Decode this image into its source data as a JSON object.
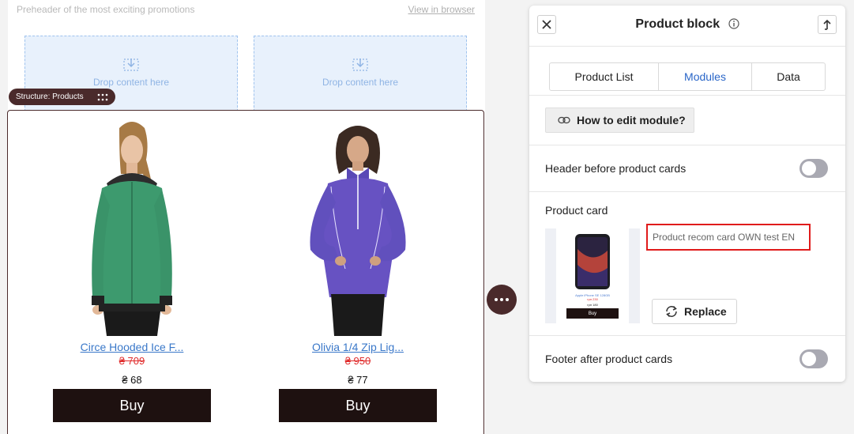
{
  "canvas": {
    "preheader": "Preheader of the most exciting promotions",
    "view_in_browser": "View in browser",
    "dropzones": [
      {
        "label": "Drop content here"
      },
      {
        "label": "Drop content here"
      }
    ],
    "structure_badge": "Structure: Products",
    "products": [
      {
        "name": "Circe Hooded Ice F...",
        "old_price": "₴ 709",
        "price": "₴ 68",
        "buy_label": "Buy",
        "image": "green-hoodie"
      },
      {
        "name": "Olivia 1/4 Zip Lig...",
        "old_price": "₴ 950",
        "price": "₴ 77",
        "buy_label": "Buy",
        "image": "purple-jacket"
      }
    ]
  },
  "panel": {
    "title": "Product block",
    "tabs": [
      {
        "label": "Product List",
        "active": false
      },
      {
        "label": "Modules",
        "active": true
      },
      {
        "label": "Data",
        "active": false
      }
    ],
    "how_to_edit": "How to edit module?",
    "header_toggle": {
      "label": "Header before product cards",
      "on": false
    },
    "product_card": {
      "section_label": "Product card",
      "card_name": "Product recom card OWN test EN",
      "replace_label": "Replace",
      "preview": {
        "name": "Apple iPhone SE 128GB",
        "old_price": "грн 230",
        "price": "грн 180",
        "buy": "Buy"
      }
    },
    "footer_toggle": {
      "label": "Footer after product cards",
      "on": false
    }
  },
  "colors": {
    "accent": "#2a66c8",
    "brand_dark": "#4a2a2b",
    "buy_button": "#1e1110",
    "highlight_red": "#e01b1b",
    "old_price": "#e02b2b",
    "dropzone_bg": "#e8f1fc"
  }
}
